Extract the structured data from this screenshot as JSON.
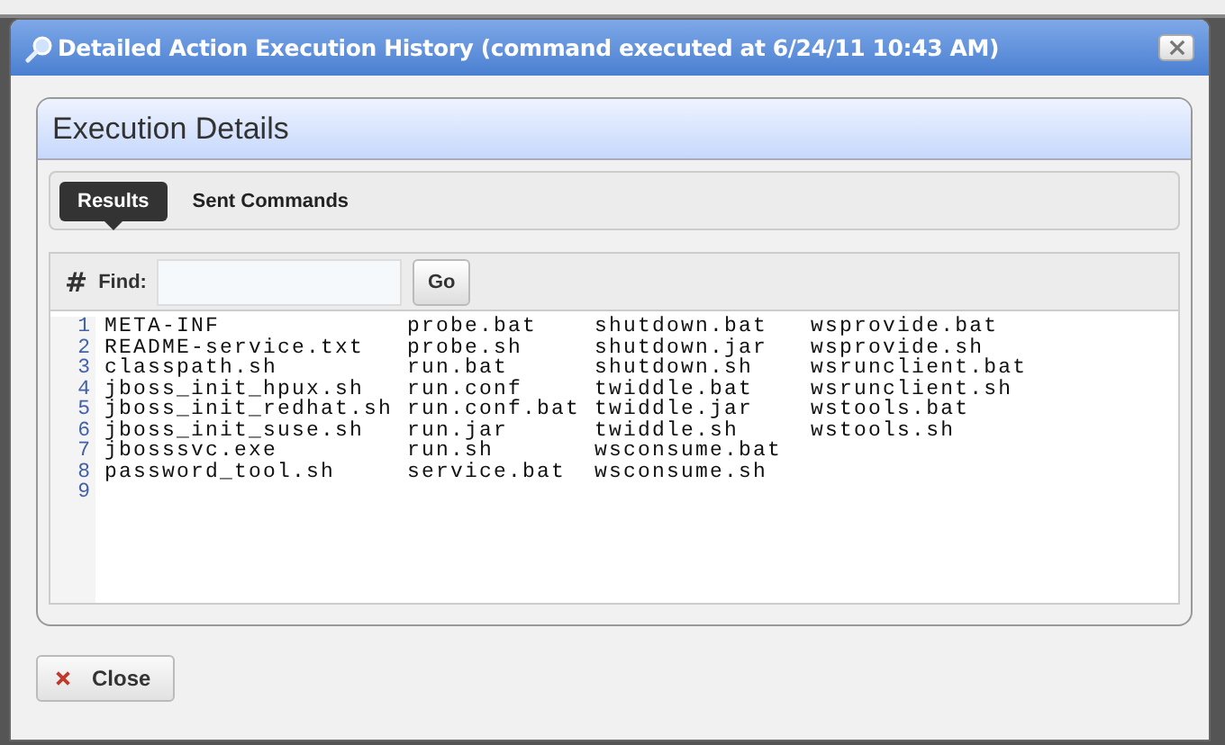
{
  "window": {
    "title": "Detailed Action Execution History (command executed at 6/24/11 10:43 AM)"
  },
  "panel": {
    "title": "Execution Details"
  },
  "tabs": [
    {
      "label": "Results",
      "selected": true
    },
    {
      "label": "Sent Commands",
      "selected": false
    }
  ],
  "find_bar": {
    "symbol": "#",
    "label": "Find:",
    "button": "Go"
  },
  "output_lines": [
    {
      "number": "1",
      "text": "META-INF             probe.bat    shutdown.bat   wsprovide.bat"
    },
    {
      "number": "2",
      "text": "README-service.txt   probe.sh     shutdown.jar   wsprovide.sh"
    },
    {
      "number": "3",
      "text": "classpath.sh         run.bat      shutdown.sh    wsrunclient.bat"
    },
    {
      "number": "4",
      "text": "jboss_init_hpux.sh   run.conf     twiddle.bat    wsrunclient.sh"
    },
    {
      "number": "5",
      "text": "jboss_init_redhat.sh run.conf.bat twiddle.jar    wstools.bat"
    },
    {
      "number": "6",
      "text": "jboss_init_suse.sh   run.jar      twiddle.sh     wstools.sh"
    },
    {
      "number": "7",
      "text": "jbosssvc.exe         run.sh       wsconsume.bat"
    },
    {
      "number": "8",
      "text": "password_tool.sh     service.bat  wsconsume.sh"
    },
    {
      "number": "9"
    }
  ],
  "buttons": [
    {
      "label": "Close",
      "kind": "close"
    }
  ]
}
